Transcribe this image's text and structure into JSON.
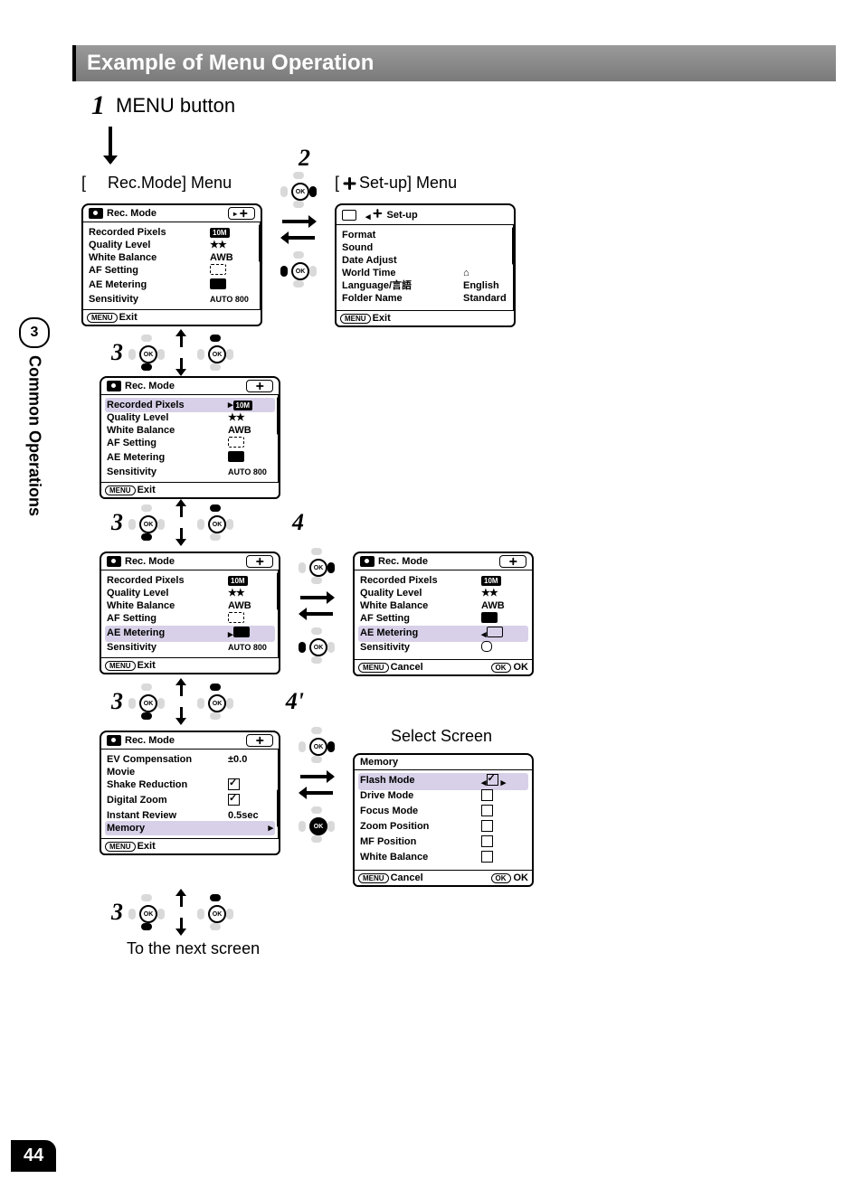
{
  "page_number": "44",
  "sidebar": {
    "section_num": "3",
    "section_title": "Common Operations"
  },
  "header": "Example of Menu Operation",
  "step1": {
    "num": "1",
    "text": "MENU button"
  },
  "menu_labels": {
    "rec_mode": "Rec.Mode] Menu",
    "setup": "Set-up] Menu"
  },
  "step_labels": {
    "s2": "2",
    "s3": "3",
    "s4": "4",
    "s4p": "4'"
  },
  "rec_menu": {
    "title": "Rec. Mode",
    "exit": "Exit",
    "menu_btn": "MENU",
    "rows": [
      {
        "label": "Recorded Pixels",
        "val": "10M",
        "pill": true
      },
      {
        "label": "Quality Level",
        "val": "★★"
      },
      {
        "label": "White Balance",
        "val": "AWB"
      },
      {
        "label": "AF Setting",
        "val": "[  ]"
      },
      {
        "label": "AE Metering",
        "val": "meter"
      },
      {
        "label": "Sensitivity",
        "val": "AUTO 800"
      }
    ]
  },
  "setup_menu": {
    "title": "Set-up",
    "exit": "Exit",
    "menu_btn": "MENU",
    "rows": [
      {
        "label": "Format",
        "val": ""
      },
      {
        "label": "Sound",
        "val": ""
      },
      {
        "label": "Date Adjust",
        "val": ""
      },
      {
        "label": "World Time",
        "val": "⌂"
      },
      {
        "label": "Language/言語",
        "val": "English"
      },
      {
        "label": "Folder Name",
        "val": "Standard"
      }
    ]
  },
  "ae_options_menu": {
    "title": "Rec. Mode",
    "cancel": "Cancel",
    "ok": "OK",
    "ok_btn": "OK",
    "menu_btn": "MENU",
    "rows": [
      {
        "label": "Recorded Pixels",
        "val": "10M",
        "pill": true
      },
      {
        "label": "Quality Level",
        "val": "★★"
      },
      {
        "label": "White Balance",
        "val": "AWB"
      },
      {
        "label": "AF Setting",
        "val": "opt1"
      },
      {
        "label": "AE Metering",
        "val": "opt2",
        "hl": true
      },
      {
        "label": "Sensitivity",
        "val": "opt3"
      }
    ]
  },
  "rec_menu_page2": {
    "title": "Rec. Mode",
    "exit": "Exit",
    "menu_btn": "MENU",
    "rows": [
      {
        "label": "EV Compensation",
        "val": "±0.0"
      },
      {
        "label": "Movie",
        "val": ""
      },
      {
        "label": "Shake Reduction",
        "val": "check"
      },
      {
        "label": "Digital Zoom",
        "val": "check"
      },
      {
        "label": "Instant Review",
        "val": "0.5sec"
      },
      {
        "label": "Memory",
        "val": "▸",
        "hl": true
      }
    ]
  },
  "select_screen_label": "Select Screen",
  "memory_menu": {
    "title": "Memory",
    "cancel": "Cancel",
    "ok": "OK",
    "ok_btn": "OK",
    "menu_btn": "MENU",
    "rows": [
      {
        "label": "Flash Mode",
        "val": "checked",
        "hl": true,
        "arrows": true
      },
      {
        "label": "Drive Mode",
        "val": "box"
      },
      {
        "label": "Focus Mode",
        "val": "box"
      },
      {
        "label": "Zoom Position",
        "val": "box"
      },
      {
        "label": "MF Position",
        "val": "box"
      },
      {
        "label": "White Balance",
        "val": "box"
      }
    ]
  },
  "final_text": "To the next screen"
}
